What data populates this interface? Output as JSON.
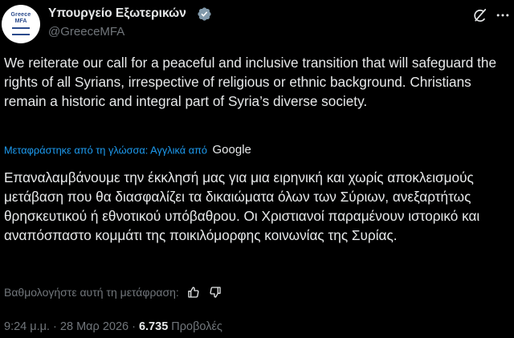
{
  "author": {
    "display_name": "Υπουργείο Εξωτερικών",
    "handle": "@GreeceMFA",
    "avatar_text_line1": "Greece",
    "avatar_text_line2": "MFA",
    "verified_badge": "verified-gray-check"
  },
  "tweet": {
    "text": "We reiterate our call for a peaceful and inclusive transition that will safeguard the rights of all Syrians, irrespective of religious or ethnic background. Christians remain a historic and integral part of Syria’s diverse society."
  },
  "translation": {
    "label": "Μεταφράστηκε από τη γλώσσα: Αγγλικά από",
    "provider": "Google",
    "text": "Επαναλαμβάνουμε την έκκλησή μας για μια ειρηνική και χωρίς αποκλεισμούς μετάβαση που θα διασφαλίζει τα δικαιώματα όλων των Σύριων, ανεξαρτήτως θρησκευτικού ή εθνοτικού υπόβαθρου. Οι Χριστιανοί παραμένουν ιστορικό και αναπόσπαστο κομμάτι της ποικιλόμορφης κοινωνίας της Συρίας."
  },
  "rating": {
    "label": "Βαθμολογήστε αυτή τη μετάφραση:",
    "up_icon": "thumbs-up-icon",
    "down_icon": "thumbs-down-icon"
  },
  "meta": {
    "time": "9:24 μ.μ.",
    "separator": " · ",
    "date": "28 Μαρ 2026",
    "views_count": "6.735",
    "views_label": "Προβολές"
  },
  "colors": {
    "background": "#000000",
    "text": "#e7e9ea",
    "secondary": "#71767b",
    "link": "#1d9bf0"
  }
}
